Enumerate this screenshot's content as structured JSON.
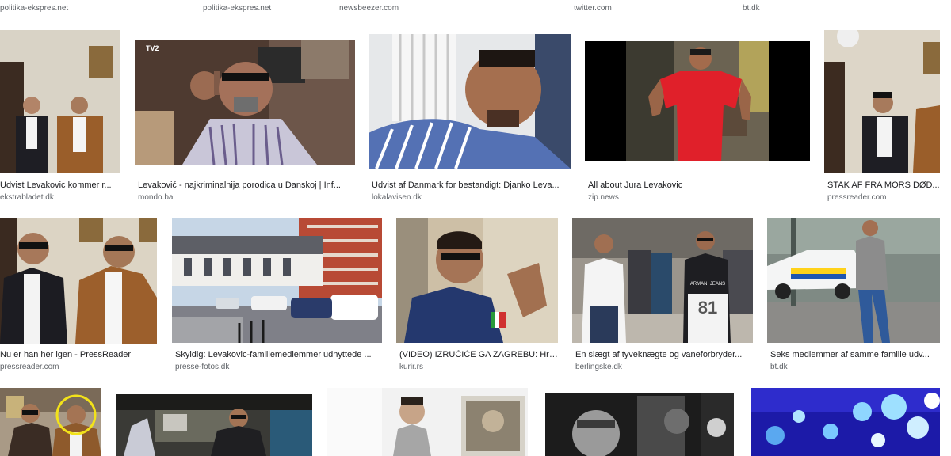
{
  "top_sources": [
    "politika-ekspres.net",
    "politika-ekspres.net",
    "newsbeezer.com",
    "twitter.com",
    "bt.dk"
  ],
  "rows": [
    {
      "items": [
        {
          "title": "Udvist Levakovic kommer r...",
          "source": "ekstrabladet.dk"
        },
        {
          "title": "Levaković - najkriminalnija porodica u Danskoj | Inf...",
          "source": "mondo.ba"
        },
        {
          "title": "Udvist af Danmark for bestandigt: Djanko Leva...",
          "source": "lokalavisen.dk"
        },
        {
          "title": "All about Jura Levakovic",
          "source": "zip.news"
        },
        {
          "title": "STAK AF FRA MORS DØD...",
          "source": "pressreader.com"
        }
      ]
    },
    {
      "items": [
        {
          "title": "Nu er han her igen - PressReader",
          "source": "pressreader.com"
        },
        {
          "title": "Skyldig: Levakovic-familiemedlemmer udnyttede ...",
          "source": "presse-fotos.dk"
        },
        {
          "title": "(VIDEO) IZRUČIĆE GA ZAGREBU: Hrv...",
          "source": "kurir.rs"
        },
        {
          "title": "En slægt af tyveknægte og vaneforbryder...",
          "source": "berlingske.dk"
        },
        {
          "title": "Seks medlemmer af samme familie udv...",
          "source": "bt.dk"
        }
      ]
    }
  ],
  "tv_logo": "TV2",
  "shirt_print": "ARMANI JEANS",
  "shirt_number": "81"
}
